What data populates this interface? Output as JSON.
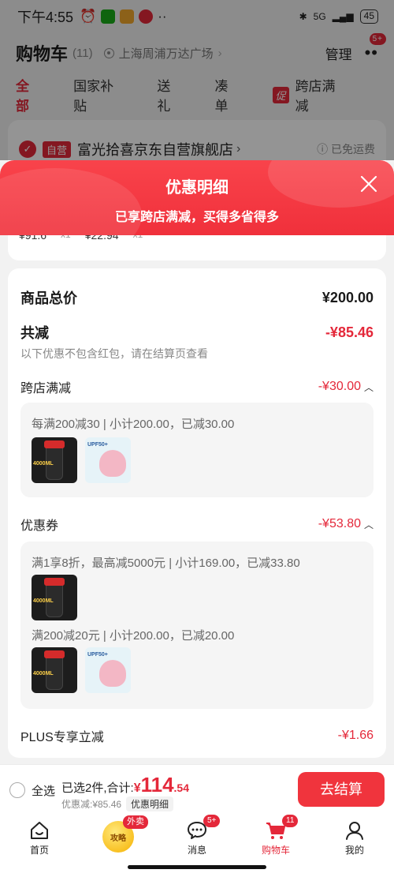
{
  "status_bar": {
    "time": "下午4:55",
    "network": "5G",
    "battery": "45"
  },
  "header": {
    "title": "购物车",
    "count": "(11)",
    "location": "上海周浦万达广场",
    "manage": "管理",
    "more_badge": "5+"
  },
  "tabs": [
    "全部",
    "国家补贴",
    "送礼",
    "凑单",
    "跨店满减"
  ],
  "tabs_promo_tag": "促",
  "shop": {
    "tag": "自营",
    "name": "富光拾喜京东自营旗舰店",
    "shipping": "已免运费",
    "peek_price_1": "¥91.6",
    "peek_qty_1": "x1",
    "peek_price_2": "¥22.94",
    "peek_qty_2": "x1"
  },
  "banner": {
    "title": "优惠明细",
    "subtitle": "已享跨店满减，买得多省得多"
  },
  "detail": {
    "total_label": "商品总价",
    "total_value": "¥200.00",
    "reduce_label": "共减",
    "reduce_value": "-¥85.46",
    "reduce_note": "以下优惠不包含红包，请在结算页查看",
    "cross_store_label": "跨店满减",
    "cross_store_value": "-¥30.00",
    "cross_store_desc": "每满200减30 | 小计200.00，已减30.00",
    "coupon_label": "优惠券",
    "coupon_value": "-¥53.80",
    "coupon_desc_1": "满1享8折，最高减5000元 | 小计169.00，已减33.80",
    "coupon_desc_2": "满200减20元 | 小计200.00，已减20.00",
    "plus_label": "PLUS专享立减",
    "plus_value": "-¥1.66",
    "product_bottle_text": "4000ML",
    "product_mask_text": "UPF50+"
  },
  "checkout": {
    "select_all": "全选",
    "selected_text": "已选2件,合计:",
    "yen": "¥",
    "amount": "114",
    "decimal": ".54",
    "discount_text": "优惠减:¥85.46",
    "detail_chip": "优惠明细",
    "pay_button": "去结算"
  },
  "tabbar": {
    "home": "首页",
    "strategy": "攻略",
    "waimai": "外卖",
    "messages": "消息",
    "messages_badge": "5+",
    "cart": "购物车",
    "cart_badge": "11",
    "mine": "我的"
  },
  "colors": {
    "accent": "#e4283a",
    "banner": "#f0303b"
  }
}
